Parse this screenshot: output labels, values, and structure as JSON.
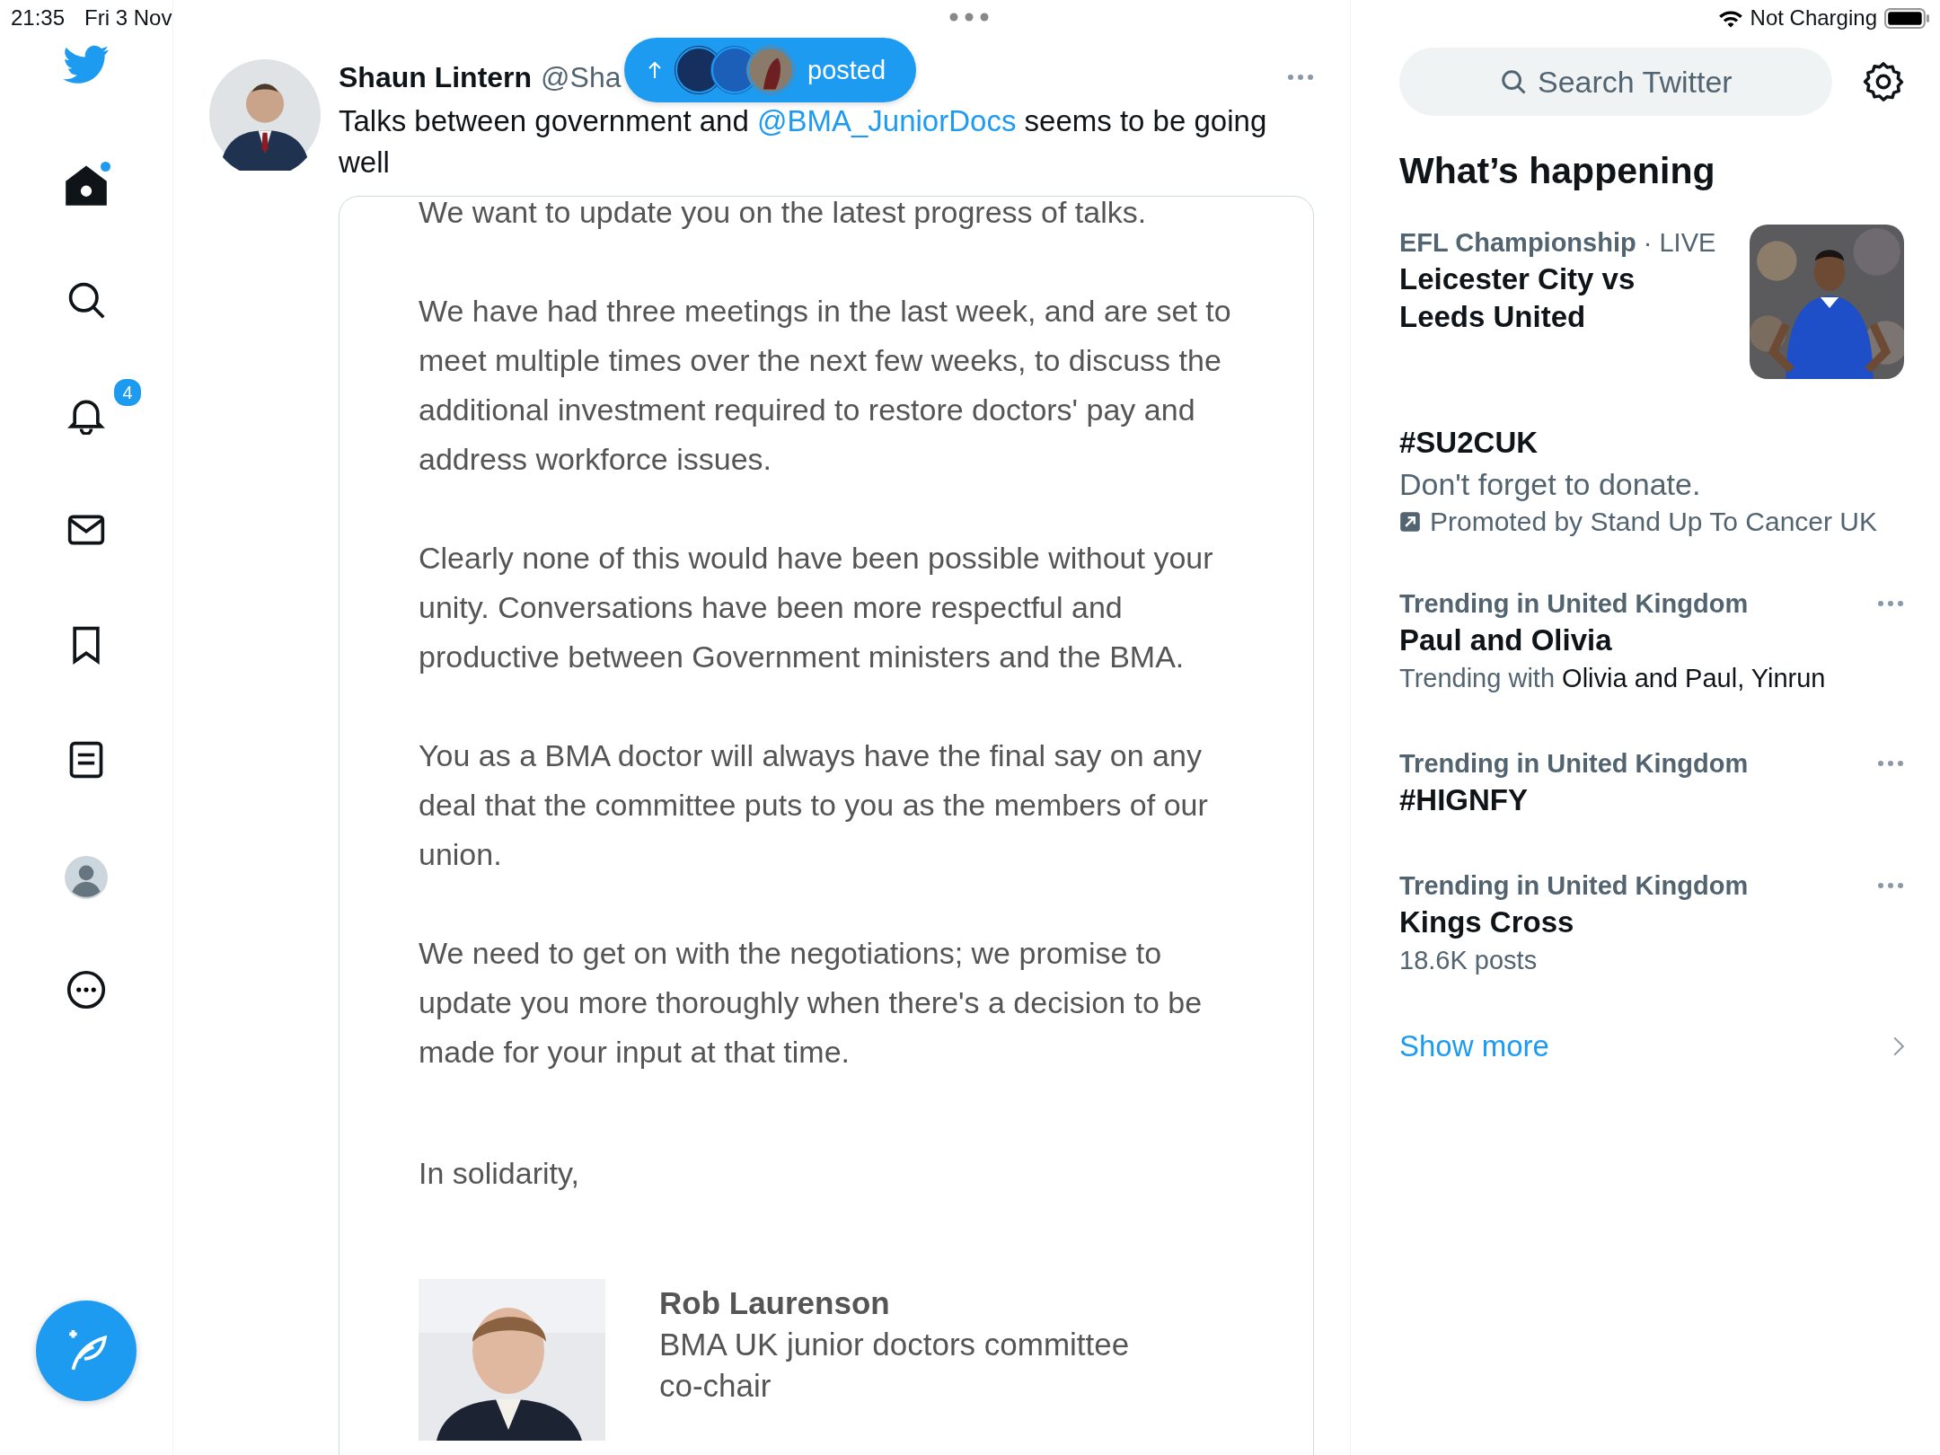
{
  "status_bar": {
    "time": "21:35",
    "date": "Fri 3 Nov",
    "battery_label": "Not Charging"
  },
  "nav": [
    {
      "kind": "logo"
    },
    {
      "kind": "home",
      "selected": true,
      "dot": true
    },
    {
      "kind": "explore",
      "selected": false
    },
    {
      "kind": "notifications",
      "selected": false,
      "badge": "4"
    },
    {
      "kind": "messages",
      "selected": false
    },
    {
      "kind": "bookmarks",
      "selected": false
    },
    {
      "kind": "lists",
      "selected": false
    },
    {
      "kind": "profile",
      "selected": false
    },
    {
      "kind": "more",
      "selected": false
    }
  ],
  "tweet": {
    "author": "Shaun Lintern",
    "handle": "@Sha",
    "text_before": "Talks between government and ",
    "mention": "@BMA_JuniorDocs",
    "text_after": " seems to be going well",
    "letter": {
      "paragraphs": [
        "We want to update you on the latest progress of talks.",
        "We have had three meetings in the last week, and are set to meet multiple times over the next few weeks, to discuss the additional investment required to restore doctors' pay and address workforce issues.",
        "Clearly none of this would have been possible without your unity. Conversations have been more respectful and productive between Government ministers and the BMA.",
        "You as a BMA doctor will always have the final say on any deal that the committee puts to you as the members of our union.",
        "We need to get on with the negotiations; we promise to update you more thoroughly when there's a decision to be made for your input at that time."
      ],
      "closing": "In solidarity,",
      "signer": "Rob Laurenson",
      "role": "BMA UK junior doctors committee co-chair"
    }
  },
  "new_posts_pill": {
    "label": "posted"
  },
  "search": {
    "placeholder": "Search Twitter"
  },
  "trends_title": "What’s happening",
  "trends": [
    {
      "kind": "event",
      "category": "EFL Championship",
      "live": "· LIVE",
      "title": "Leicester City vs Leeds United"
    },
    {
      "kind": "promoted",
      "title": "#SU2CUK",
      "description": "Don't forget to donate.",
      "promoter": "Promoted by Stand Up To Cancer UK"
    },
    {
      "kind": "trend",
      "category": "Trending in United Kingdom",
      "title": "Paul and Olivia",
      "context_label": "Trending with",
      "context": "Olivia and Paul, Yinrun"
    },
    {
      "kind": "trend",
      "category": "Trending in United Kingdom",
      "title": "#HIGNFY"
    },
    {
      "kind": "trend",
      "category": "Trending in United Kingdom",
      "title": "Kings Cross",
      "posts": "18.6K posts"
    }
  ],
  "show_more": "Show more"
}
